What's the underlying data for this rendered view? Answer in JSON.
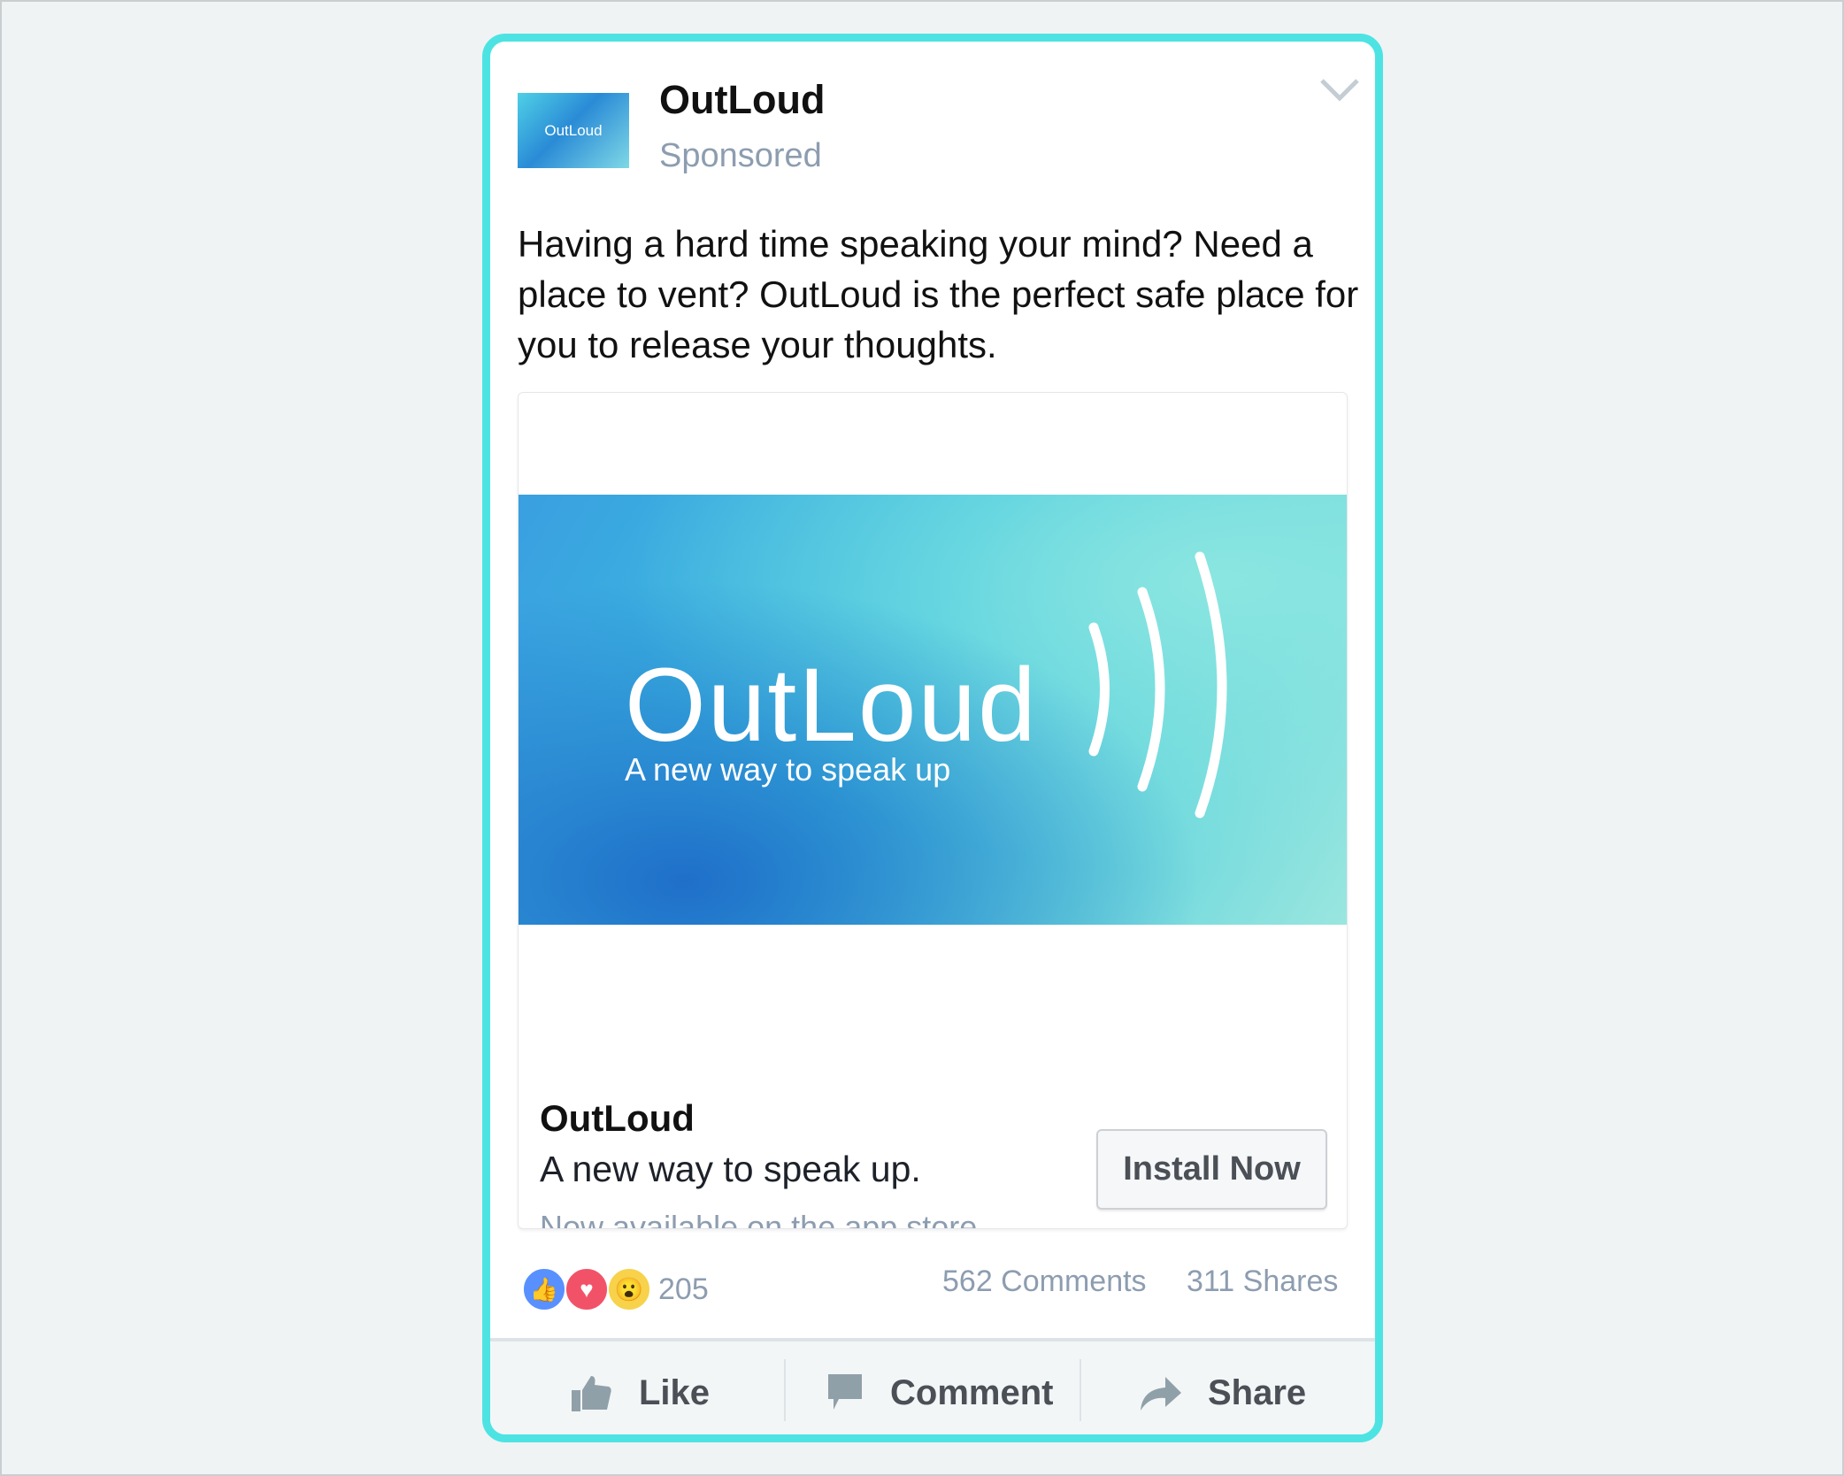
{
  "post": {
    "page_name": "OutLoud",
    "sponsored": "Sponsored",
    "thumb_text": "OutLoud",
    "text": "Having a hard time speaking your mind? Need a place to vent? OutLoud is the perfect safe place for you to release your thoughts.",
    "menu_icon": "chevron-down-icon"
  },
  "link": {
    "banner_logo": "OutLoud",
    "banner_tagline": "A new way to speak up",
    "title": "OutLoud",
    "description": "A new way to speak up.",
    "note": "Now available on the app store.",
    "cta": "Install Now"
  },
  "stats": {
    "reactions": "205",
    "comments": "562 Comments",
    "shares": "311 Shares"
  },
  "actions": {
    "like": "Like",
    "comment": "Comment",
    "share": "Share"
  },
  "colors": {
    "accent_border": "#4de3e3",
    "like": "#5890ff",
    "love": "#f25268",
    "wow": "#f7d24a"
  }
}
